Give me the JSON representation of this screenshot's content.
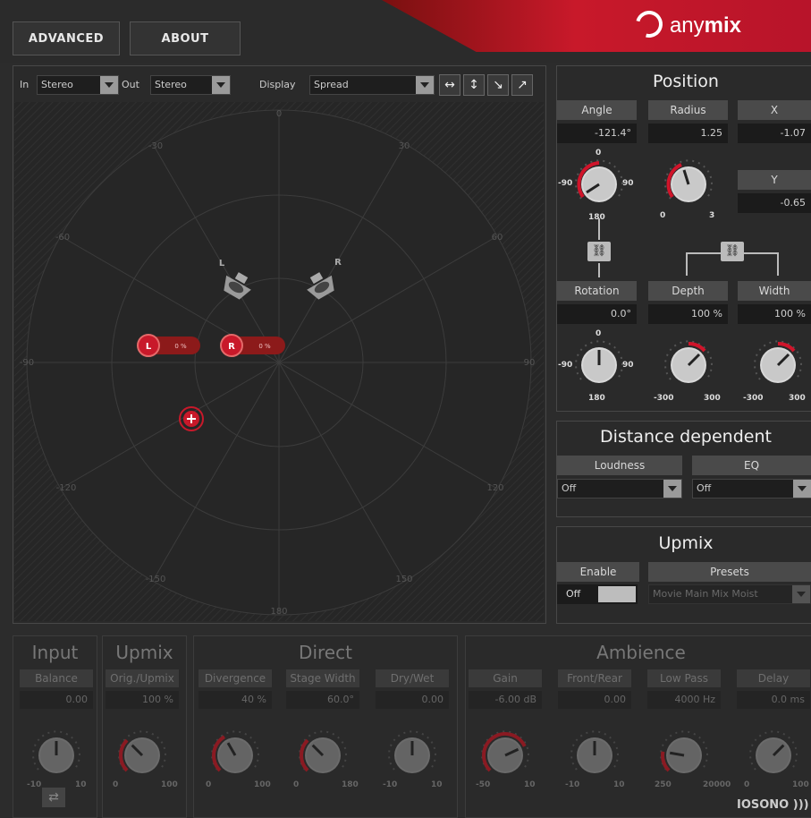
{
  "header": {
    "advanced_label": "ADVANCED",
    "about_label": "ABOUT",
    "brand_prefix": "any",
    "brand_suffix": "mix",
    "brand_color": "#c8192a"
  },
  "panner": {
    "in_label": "In",
    "in_value": "Stereo",
    "out_label": "Out",
    "out_value": "Stereo",
    "display_label": "Display",
    "display_value": "Spread",
    "tools": [
      "horizontal-arrows-icon",
      "vertical-arrows-icon",
      "diagonal-down-icon",
      "diagonal-up-icon"
    ],
    "angle_labels": {
      "top": "0",
      "tl": "-30",
      "tr": "30",
      "l60": "-60",
      "r60": "60",
      "l90": "-90",
      "r90": "90",
      "l120": "-120",
      "r120": "120",
      "l150": "-150",
      "r150": "150",
      "bottom": "180"
    },
    "speaker_l": "L",
    "speaker_r": "R",
    "chip_l_label": "L",
    "chip_l_value": "0 %",
    "chip_r_label": "R",
    "chip_r_value": "0 %"
  },
  "position": {
    "title": "Position",
    "angle": {
      "label": "Angle",
      "value": "-121.4°",
      "min": "-90",
      "max": "90",
      "top": "0",
      "bottom": "180"
    },
    "radius": {
      "label": "Radius",
      "value": "1.25",
      "min": "0",
      "max": "3"
    },
    "x": {
      "label": "X",
      "value": "-1.07"
    },
    "y": {
      "label": "Y",
      "value": "-0.65"
    },
    "rotation": {
      "label": "Rotation",
      "value": "0.0°",
      "min": "-90",
      "max": "90",
      "top": "0",
      "bottom": "180"
    },
    "depth": {
      "label": "Depth",
      "value": "100 %",
      "min": "-300",
      "max": "300"
    },
    "width": {
      "label": "Width",
      "value": "100 %",
      "min": "-300",
      "max": "300"
    }
  },
  "distance": {
    "title": "Distance dependent",
    "loudness_label": "Loudness",
    "loudness_value": "Off",
    "eq_label": "EQ",
    "eq_value": "Off"
  },
  "upmix_panel": {
    "title": "Upmix",
    "enable_label": "Enable",
    "enable_state": "Off",
    "presets_label": "Presets",
    "presets_value": "Movie Main Mix Moist"
  },
  "bottom": {
    "input_title": "Input",
    "upmix_title": "Upmix",
    "direct_title": "Direct",
    "ambience_title": "Ambience",
    "controls": [
      {
        "label": "Balance",
        "value": "0.00",
        "min": "-10",
        "max": "10"
      },
      {
        "label": "Orig./Upmix",
        "value": "100 %",
        "min": "0",
        "max": "100"
      },
      {
        "label": "Divergence",
        "value": "40 %",
        "min": "0",
        "max": "100"
      },
      {
        "label": "Stage Width",
        "value": "60.0°",
        "min": "0",
        "max": "180"
      },
      {
        "label": "Dry/Wet",
        "value": "0.00",
        "min": "-10",
        "max": "10"
      },
      {
        "label": "Gain",
        "value": "-6.00 dB",
        "min": "-50",
        "max": "10"
      },
      {
        "label": "Front/Rear",
        "value": "0.00",
        "min": "-10",
        "max": "10"
      },
      {
        "label": "Low Pass",
        "value": "4000 Hz",
        "min": "250",
        "max": "20000"
      },
      {
        "label": "Delay",
        "value": "0.0 ms",
        "min": "0",
        "max": "100"
      }
    ],
    "footer_brand": "IOSONO )))"
  }
}
